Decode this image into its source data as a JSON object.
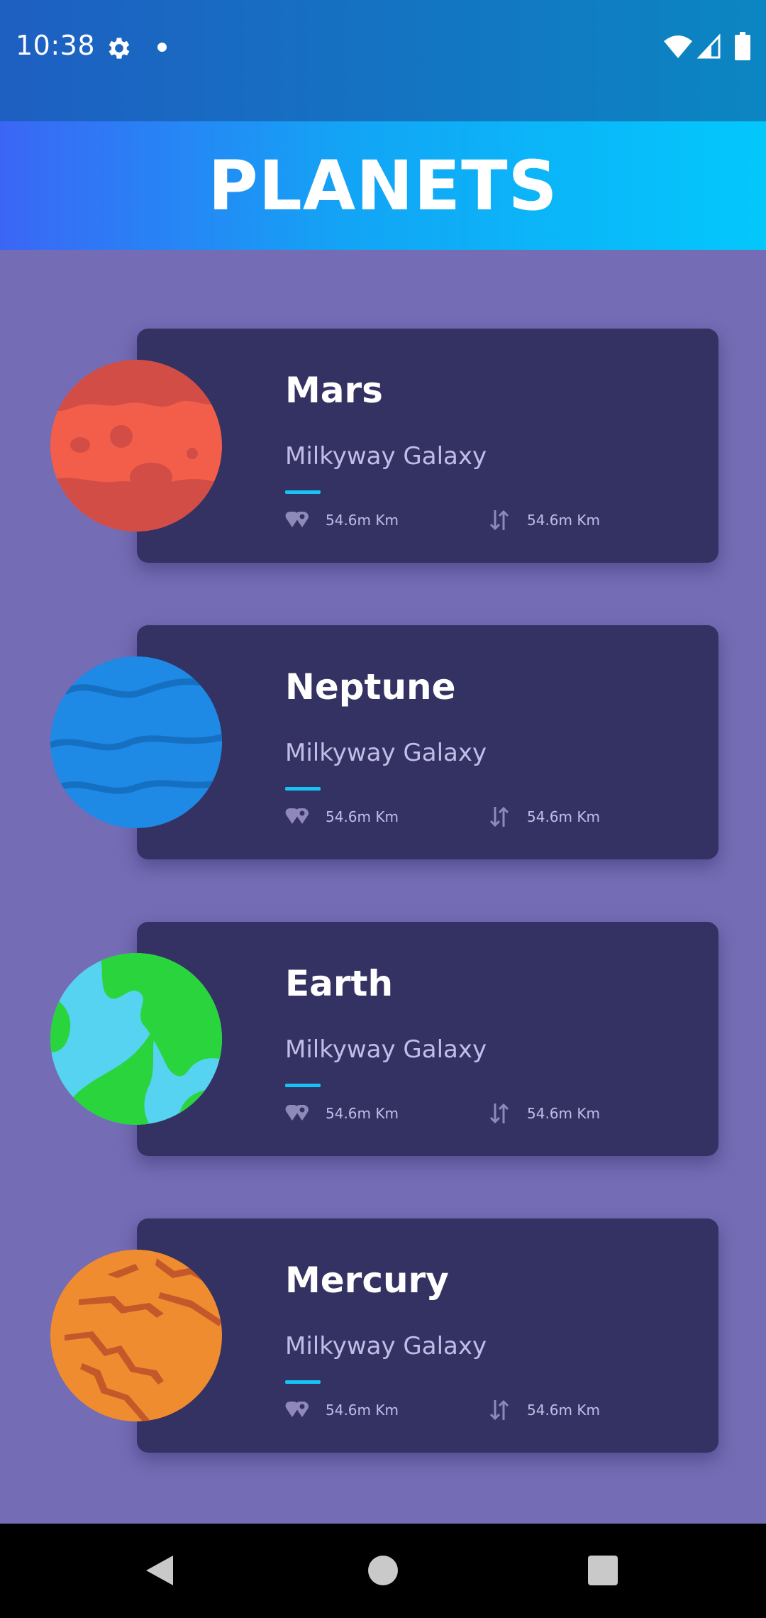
{
  "status_bar": {
    "time": "10:38",
    "icons": [
      "gear-icon",
      "dot-icon",
      "wifi-icon",
      "signal-icon",
      "battery-icon"
    ]
  },
  "app_bar": {
    "title": "PLANETS"
  },
  "colors": {
    "card_background": "#343262",
    "page_background": "#746cb4",
    "accent": "#17c3f5"
  },
  "planets": [
    {
      "name": "Mars",
      "galaxy": "Milkyway Galaxy",
      "distance": "54.6m Km",
      "gravity": "54.6m Km",
      "image": "mars-planet"
    },
    {
      "name": "Neptune",
      "galaxy": "Milkyway Galaxy",
      "distance": "54.6m Km",
      "gravity": "54.6m Km",
      "image": "neptune-planet"
    },
    {
      "name": "Earth",
      "galaxy": "Milkyway Galaxy",
      "distance": "54.6m Km",
      "gravity": "54.6m Km",
      "image": "earth-planet"
    },
    {
      "name": "Mercury",
      "galaxy": "Milkyway Galaxy",
      "distance": "54.6m Km",
      "gravity": "54.6m Km",
      "image": "mercury-planet"
    }
  ],
  "nav_bar": {
    "icons": [
      "back-icon",
      "home-icon",
      "recents-icon"
    ]
  }
}
